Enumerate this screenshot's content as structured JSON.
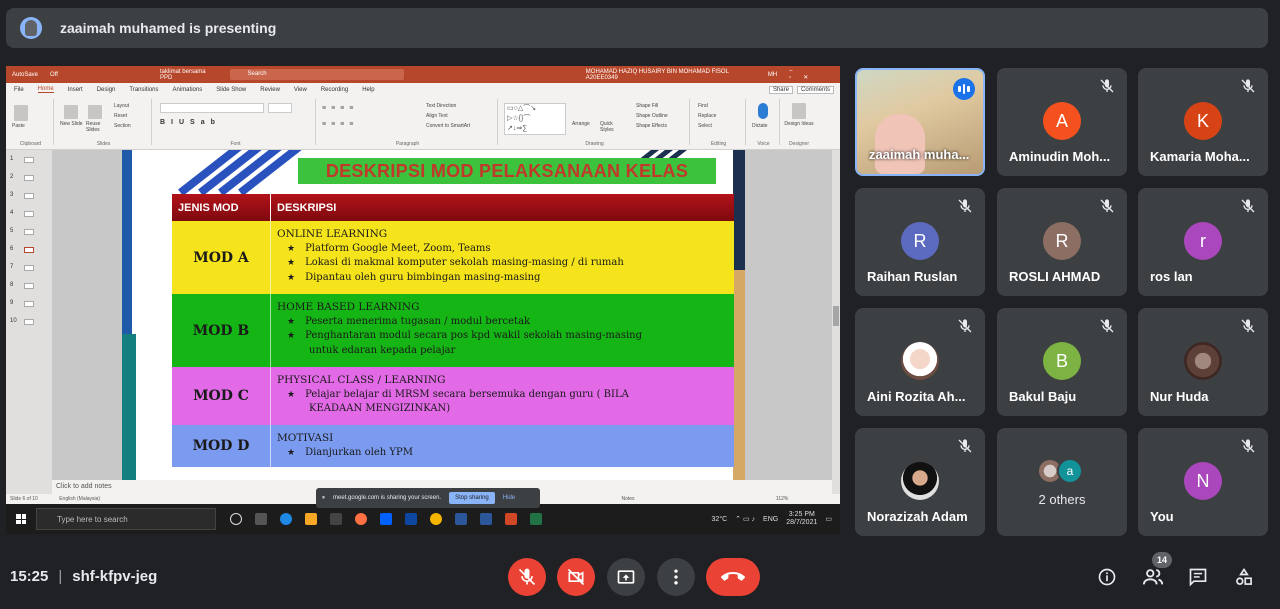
{
  "presenter_banner": {
    "text": "zaaimah muhamed is presenting"
  },
  "shared_screen": {
    "ppt_titlebar": {
      "autosave": "AutoSave",
      "autosave_state": "Off",
      "doc_name": "taklimat bersama PPD",
      "search": "Search",
      "user_name": "MOHAMAD HAZIQ HUSAIRY BIN MOHAMAD FISOL A20EE0349",
      "user_initials": "MH"
    },
    "ppt_menu": [
      "File",
      "Home",
      "Insert",
      "Design",
      "Transitions",
      "Animations",
      "Slide Show",
      "Review",
      "View",
      "Recording",
      "Help"
    ],
    "ppt_active_tab": "Home",
    "ppt_menu_right": [
      "Share",
      "Comments"
    ],
    "ribbon_groups": [
      "Clipboard",
      "Slides",
      "Font",
      "Paragraph",
      "Drawing",
      "Editing",
      "Voice",
      "Designer"
    ],
    "ribbon_labels": {
      "paste": "Paste",
      "new_slide": "New Slide",
      "reuse": "Reuse Slides",
      "layout": "Layout",
      "reset": "Reset",
      "section": "Section",
      "text_direction": "Text Direction",
      "align_text": "Align Text",
      "smartart": "Convert to SmartArt",
      "arrange": "Arrange",
      "quick_styles": "Quick Styles",
      "shape_fill": "Shape Fill",
      "shape_outline": "Shape Outline",
      "shape_effects": "Shape Effects",
      "find": "Find",
      "replace": "Replace",
      "select": "Select",
      "dictate": "Dictate",
      "design_ideas": "Design Ideas"
    },
    "thumbnail_numbers": [
      "1",
      "2",
      "3",
      "4",
      "5",
      "6",
      "7",
      "8",
      "9",
      "10"
    ],
    "slide": {
      "title": "DESKRIPSI MOD PELAKSANAAN KELAS",
      "header_col1": "JENIS MOD",
      "header_col2": "DESKRIPSI",
      "rows": [
        {
          "mod": "MOD A",
          "heading": "ONLINE LEARNING",
          "bullets": [
            "Platform Google Meet, Zoom, Teams",
            "Lokasi di makmal komputer sekolah masing-masing / di rumah",
            "Dipantau oleh guru bimbingan masing-masing"
          ],
          "continuation": ""
        },
        {
          "mod": "MOD B",
          "heading": "HOME BASED LEARNING",
          "bullets": [
            "Peserta menerima tugasan / modul bercetak",
            "Penghantaran modul secara pos kpd wakil sekolah masing-masing"
          ],
          "continuation": "untuk edaran kepada pelajar"
        },
        {
          "mod": "MOD C",
          "heading": "PHYSICAL CLASS / LEARNING",
          "bullets": [
            "Pelajar belajar di MRSM secara bersemuka dengan guru ( BILA"
          ],
          "continuation": "KEADAAN MENGIZINKAN)"
        },
        {
          "mod": "MOD D",
          "heading": "MOTIVASI",
          "bullets": [
            "Dianjurkan oleh YPM"
          ],
          "continuation": ""
        }
      ]
    },
    "notes_placeholder": "Click to add notes",
    "status_left": "Slide 6 of 10",
    "status_lang": "English (Malaysia)",
    "status_notes": "Notes",
    "status_zoom": "112%",
    "share_notice": "meet.google.com is sharing your screen.",
    "stop_sharing": "Stop sharing",
    "hide": "Hide",
    "taskbar": {
      "search_placeholder": "Type here to search",
      "temperature": "32°C",
      "lang": "ENG",
      "time": "3:25 PM",
      "date": "28/7/2021"
    }
  },
  "participants": [
    {
      "name": "zaaimah muha...",
      "initial": "",
      "color": "",
      "speaking": true
    },
    {
      "name": "Aminudin Moh...",
      "initial": "A",
      "color": "#f4511e"
    },
    {
      "name": "Kamaria Moha...",
      "initial": "K",
      "color": "#d84315"
    },
    {
      "name": "Raihan Ruslan",
      "initial": "R",
      "color": "#5c6bc0"
    },
    {
      "name": "ROSLI AHMAD",
      "initial": "R",
      "color": "#8d6e63"
    },
    {
      "name": "ros lan",
      "initial": "r",
      "color": "#ab47bc"
    },
    {
      "name": "Aini Rozita Ah...",
      "initial": "",
      "color": ""
    },
    {
      "name": "Bakul Baju",
      "initial": "B",
      "color": "#7cb342"
    },
    {
      "name": "Nur Huda",
      "initial": "",
      "color": ""
    },
    {
      "name": "Norazizah Adam",
      "initial": "",
      "color": ""
    },
    {
      "name": "2 others",
      "initial": "a",
      "color": "#12939a"
    },
    {
      "name": "You",
      "initial": "N",
      "color": "#ab47bc"
    }
  ],
  "bottom_bar": {
    "time": "15:25",
    "separator": "|",
    "meeting_code": "shf-kfpv-jeg",
    "people_count": "14"
  },
  "colors": {
    "background": "#202124",
    "tile": "#3c4043",
    "danger": "#ea4335",
    "accent": "#8ab4f8"
  },
  "icons": [
    "mic-off-icon",
    "camera-off-icon",
    "present-icon",
    "more-icon",
    "hang-up-icon",
    "info-icon",
    "people-icon",
    "chat-icon",
    "activities-icon"
  ]
}
